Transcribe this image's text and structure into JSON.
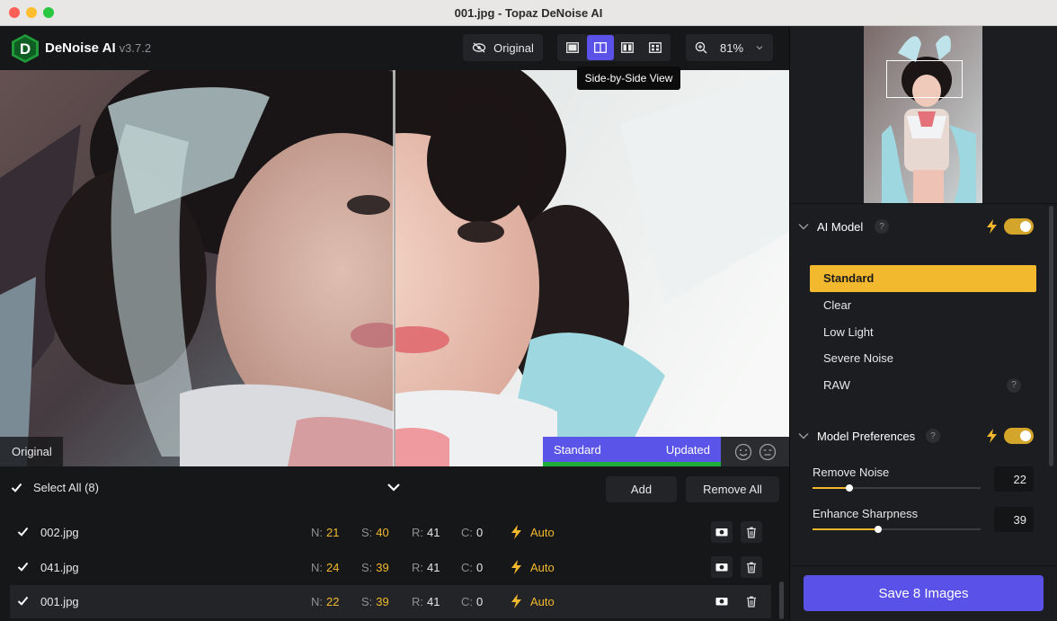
{
  "window": {
    "title": "001.jpg - Topaz DeNoise AI"
  },
  "app": {
    "name": "DeNoise AI",
    "version": "v3.7.2"
  },
  "toolbar": {
    "original_label": "Original",
    "view_tooltip": "Side-by-Side View",
    "zoom": "81%"
  },
  "preview": {
    "original_label": "Original",
    "model_status": "Standard",
    "update_status": "Updated"
  },
  "filelist": {
    "select_all": "Select All (8)",
    "add_label": "Add",
    "remove_all_label": "Remove All",
    "rows": [
      {
        "name": "002.jpg",
        "n": "21",
        "s": "40",
        "r": "41",
        "c": "0",
        "mode": "Auto"
      },
      {
        "name": "041.jpg",
        "n": "24",
        "s": "39",
        "r": "41",
        "c": "0",
        "mode": "Auto"
      },
      {
        "name": "001.jpg",
        "n": "22",
        "s": "39",
        "r": "41",
        "c": "0",
        "mode": "Auto"
      }
    ],
    "labels": {
      "n": "N:",
      "s": "S:",
      "r": "R:",
      "c": "C:"
    }
  },
  "panel": {
    "ai_model": {
      "title": "AI Model",
      "help": "?",
      "models": [
        "Standard",
        "Clear",
        "Low Light",
        "Severe Noise",
        "RAW"
      ],
      "selected": "Standard"
    },
    "preferences": {
      "title": "Model Preferences",
      "help": "?",
      "remove_noise_label": "Remove Noise",
      "remove_noise_value": "22",
      "enhance_sharpness_label": "Enhance Sharpness",
      "enhance_sharpness_value": "39",
      "remove_noise_fraction": 0.22,
      "enhance_sharpness_fraction": 0.39
    },
    "save_label": "Save 8 Images"
  },
  "colors": {
    "accent": "#5b52ea",
    "highlight": "#f2b92e",
    "progress": "#1fae3b"
  }
}
